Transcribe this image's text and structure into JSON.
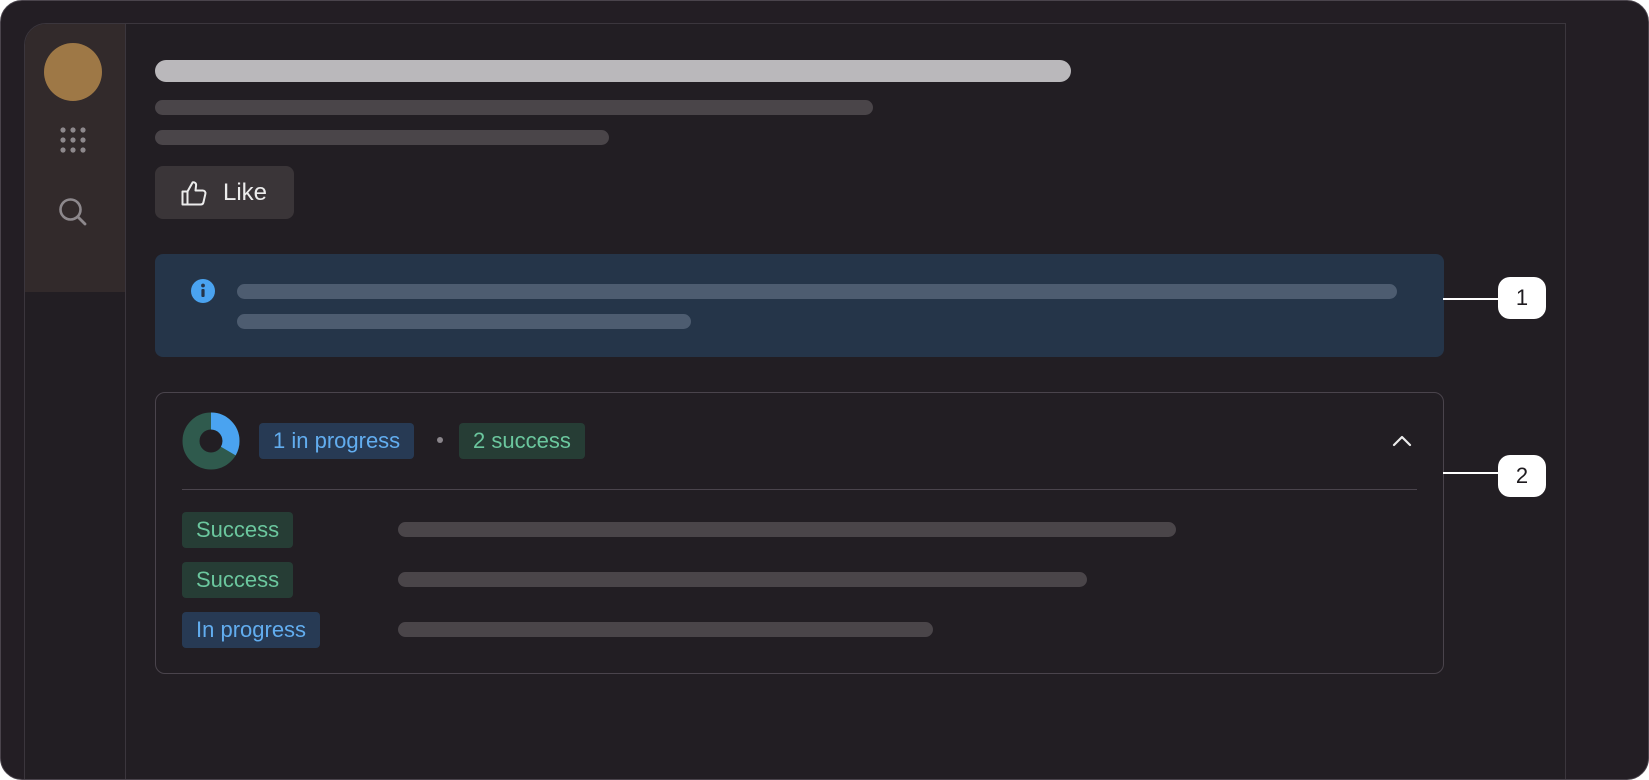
{
  "like_button": {
    "label": "Like"
  },
  "status_summary": {
    "in_progress_label": "1 in progress",
    "success_label": "2 success",
    "donut": {
      "in_progress": 1,
      "success": 2
    }
  },
  "status_rows": [
    {
      "status": "Success",
      "kind": "success"
    },
    {
      "status": "Success",
      "kind": "success"
    },
    {
      "status": "In progress",
      "kind": "progress"
    }
  ],
  "callouts": [
    "1",
    "2"
  ],
  "colors": {
    "progress_text": "#62adef",
    "success_text": "#6bc79e",
    "info_background": "#253549",
    "avatar": "#9e7846"
  },
  "icons": {
    "sidebar": [
      "apps-icon",
      "search-icon"
    ],
    "like": "thumbs-up-icon",
    "info": "info-icon",
    "toggle": "chevron-up-icon"
  }
}
